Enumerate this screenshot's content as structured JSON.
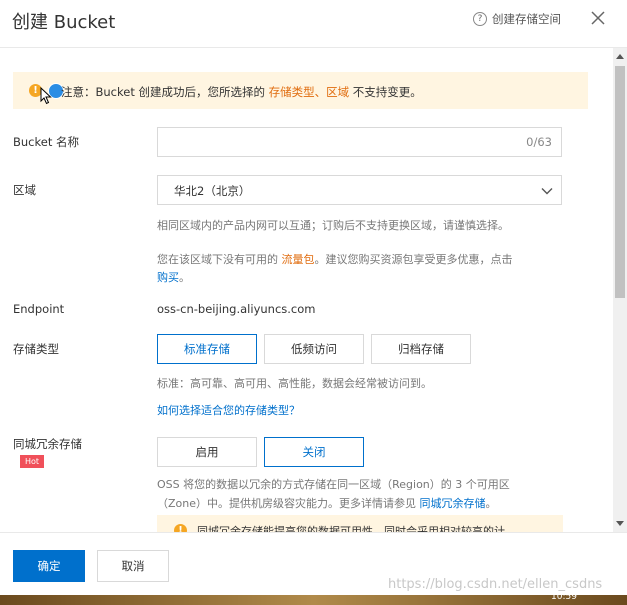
{
  "dialog": {
    "title": "创建 Bucket",
    "help_label": "创建存储空间",
    "help_icon_glyph": "?"
  },
  "notice": {
    "prefix": "注意：Bucket 创建成功后，您所选择的 ",
    "link_storage_type": "存储类型",
    "separator": "、",
    "link_region": "区域",
    "suffix": " 不支持变更。"
  },
  "form": {
    "bucket_name": {
      "label": "Bucket 名称",
      "value": "",
      "counter": "0/63"
    },
    "region": {
      "label": "区域",
      "selected": "华北2（北京）",
      "hint1": "相同区域内的产品内网可以互通；订购后不支持更换区域，请谨慎选择。",
      "hint2_prefix": "您在该区域下没有可用的 ",
      "hint2_link": "流量包",
      "hint2_suffix": "。建议您购买资源包享受更多优惠，点击",
      "hint2_link2": "购买",
      "hint2_end": "。"
    },
    "endpoint": {
      "label": "Endpoint",
      "value": "oss-cn-beijing.aliyuncs.com"
    },
    "storage_class": {
      "label": "存储类型",
      "options": [
        "标准存储",
        "低频访问",
        "归档存储"
      ],
      "selected_index": 0,
      "hint": "标准：高可靠、高可用、高性能，数据会经常被访问到。",
      "help_link": "如何选择适合您的存储类型？"
    },
    "zone_redundancy": {
      "label": "同城冗余存储",
      "badge": "Hot",
      "options": [
        "启用",
        "关闭"
      ],
      "selected_index": 1,
      "hint_line1": "OSS 将您的数据以冗余的方式存储在同一区域（Region）的 3 个可用区",
      "hint_line2_prefix": "（Zone）中。提供机房级容灾能力。更多详情请参见 ",
      "hint_line2_link": "同城冗余存储",
      "hint_line2_end": "。",
      "warning": "同城冗余存储能提高您的数据可用性，同时会采用相对较高的计"
    }
  },
  "footer": {
    "ok_label": "确定",
    "cancel_label": "取消"
  },
  "watermark": "https://blog.csdn.net/ellen_csdns",
  "taskbar_time": "10:59",
  "colors": {
    "primary": "#0070cc",
    "accent_orange": "#e06c0e",
    "notice_bg": "#fff5e1",
    "hot_badge": "#f0505a"
  }
}
